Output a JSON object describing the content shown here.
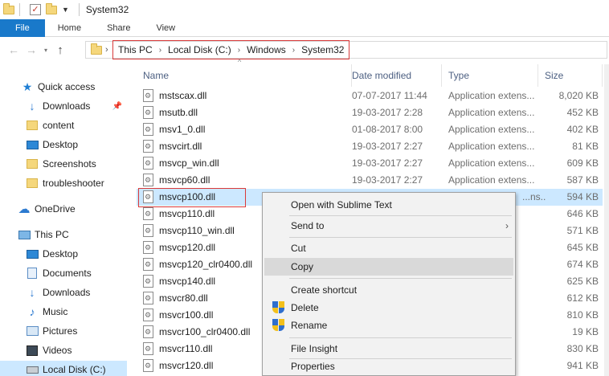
{
  "window": {
    "title": "System32"
  },
  "ribbon": {
    "tabs": [
      "File",
      "Home",
      "Share",
      "View"
    ]
  },
  "address": {
    "crumbs": [
      "This PC",
      "Local Disk (C:)",
      "Windows",
      "System32"
    ]
  },
  "sidebar": {
    "items": [
      {
        "label": "Quick access",
        "icon": "star-icon"
      },
      {
        "label": "Downloads",
        "icon": "download-icon",
        "pinned": true
      },
      {
        "label": "content",
        "icon": "folder-icon"
      },
      {
        "label": "Desktop",
        "icon": "desktop-icon"
      },
      {
        "label": "Screenshots",
        "icon": "folder-icon"
      },
      {
        "label": "troubleshooter",
        "icon": "folder-icon"
      },
      {
        "label": "OneDrive",
        "icon": "cloud-icon"
      },
      {
        "label": "This PC",
        "icon": "computer-icon"
      },
      {
        "label": "Desktop",
        "icon": "desktop-icon"
      },
      {
        "label": "Documents",
        "icon": "documents-icon"
      },
      {
        "label": "Downloads",
        "icon": "download-icon"
      },
      {
        "label": "Music",
        "icon": "music-icon"
      },
      {
        "label": "Pictures",
        "icon": "pictures-icon"
      },
      {
        "label": "Videos",
        "icon": "videos-icon"
      },
      {
        "label": "Local Disk (C:)",
        "icon": "disk-icon",
        "selected": true
      }
    ]
  },
  "columns": {
    "name": "Name",
    "date": "Date modified",
    "type": "Type",
    "size": "Size"
  },
  "files": [
    {
      "name": "mstscax.dll",
      "date": "07-07-2017 11:44",
      "type": "Application extens...",
      "size": "8,020 KB"
    },
    {
      "name": "msutb.dll",
      "date": "19-03-2017 2:28",
      "type": "Application extens...",
      "size": "452 KB"
    },
    {
      "name": "msv1_0.dll",
      "date": "01-08-2017 8:00",
      "type": "Application extens...",
      "size": "402 KB"
    },
    {
      "name": "msvcirt.dll",
      "date": "19-03-2017 2:27",
      "type": "Application extens...",
      "size": "81 KB"
    },
    {
      "name": "msvcp_win.dll",
      "date": "19-03-2017 2:27",
      "type": "Application extens...",
      "size": "609 KB"
    },
    {
      "name": "msvcp60.dll",
      "date": "19-03-2017 2:27",
      "type": "Application extens...",
      "size": "587 KB"
    },
    {
      "name": "msvcp100.dll",
      "date": "",
      "type": "...ns...",
      "size": "594 KB",
      "selected": true
    },
    {
      "name": "msvcp110.dll",
      "date": "",
      "type": "",
      "size": "646 KB"
    },
    {
      "name": "msvcp110_win.dll",
      "date": "",
      "type": "",
      "size": "571 KB"
    },
    {
      "name": "msvcp120.dll",
      "date": "",
      "type": "",
      "size": "645 KB"
    },
    {
      "name": "msvcp120_clr0400.dll",
      "date": "",
      "type": "",
      "size": "674 KB"
    },
    {
      "name": "msvcp140.dll",
      "date": "",
      "type": "",
      "size": "625 KB"
    },
    {
      "name": "msvcr80.dll",
      "date": "",
      "type": "",
      "size": "612 KB"
    },
    {
      "name": "msvcr100.dll",
      "date": "",
      "type": "",
      "size": "810 KB"
    },
    {
      "name": "msvcr100_clr0400.dll",
      "date": "",
      "type": "",
      "size": "19 KB"
    },
    {
      "name": "msvcr110.dll",
      "date": "",
      "type": "",
      "size": "830 KB"
    },
    {
      "name": "msvcr120.dll",
      "date": "",
      "type": "",
      "size": "941 KB"
    }
  ],
  "context_menu": {
    "open_with": "Open with Sublime Text",
    "send_to": "Send to",
    "cut": "Cut",
    "copy": "Copy",
    "create_shortcut": "Create shortcut",
    "delete": "Delete",
    "rename": "Rename",
    "file_insight": "File Insight",
    "properties": "Properties"
  },
  "colors": {
    "accent": "#1979ca",
    "selection": "#cce8ff",
    "highlight": "#d93a3a"
  }
}
